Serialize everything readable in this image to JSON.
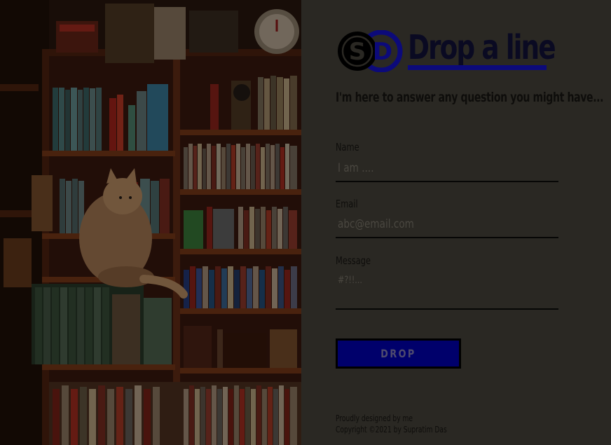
{
  "colors": {
    "panel_background": "#2a2823",
    "accent_blue": "#0c0a7a",
    "button_fill": "#00006b",
    "underline": "#070706"
  },
  "illustration": {
    "subject": "bookshelf-with-cat-illustration"
  },
  "logo": {
    "letters": "SD",
    "icon": "sd-monogram-icon"
  },
  "header": {
    "title": "Drop a line",
    "tagline": "I'm here to answer any question you might have..."
  },
  "form": {
    "name": {
      "label": "Name",
      "placeholder": "I am ...."
    },
    "email": {
      "label": "Email",
      "placeholder": "abc@email.com"
    },
    "message": {
      "label": "Message",
      "placeholder": "#?!!..."
    },
    "submit_label": "DROP"
  },
  "footer": {
    "line1": "Proudly designed by me",
    "line2": "Copyright ©2021 by Supratim Das"
  }
}
